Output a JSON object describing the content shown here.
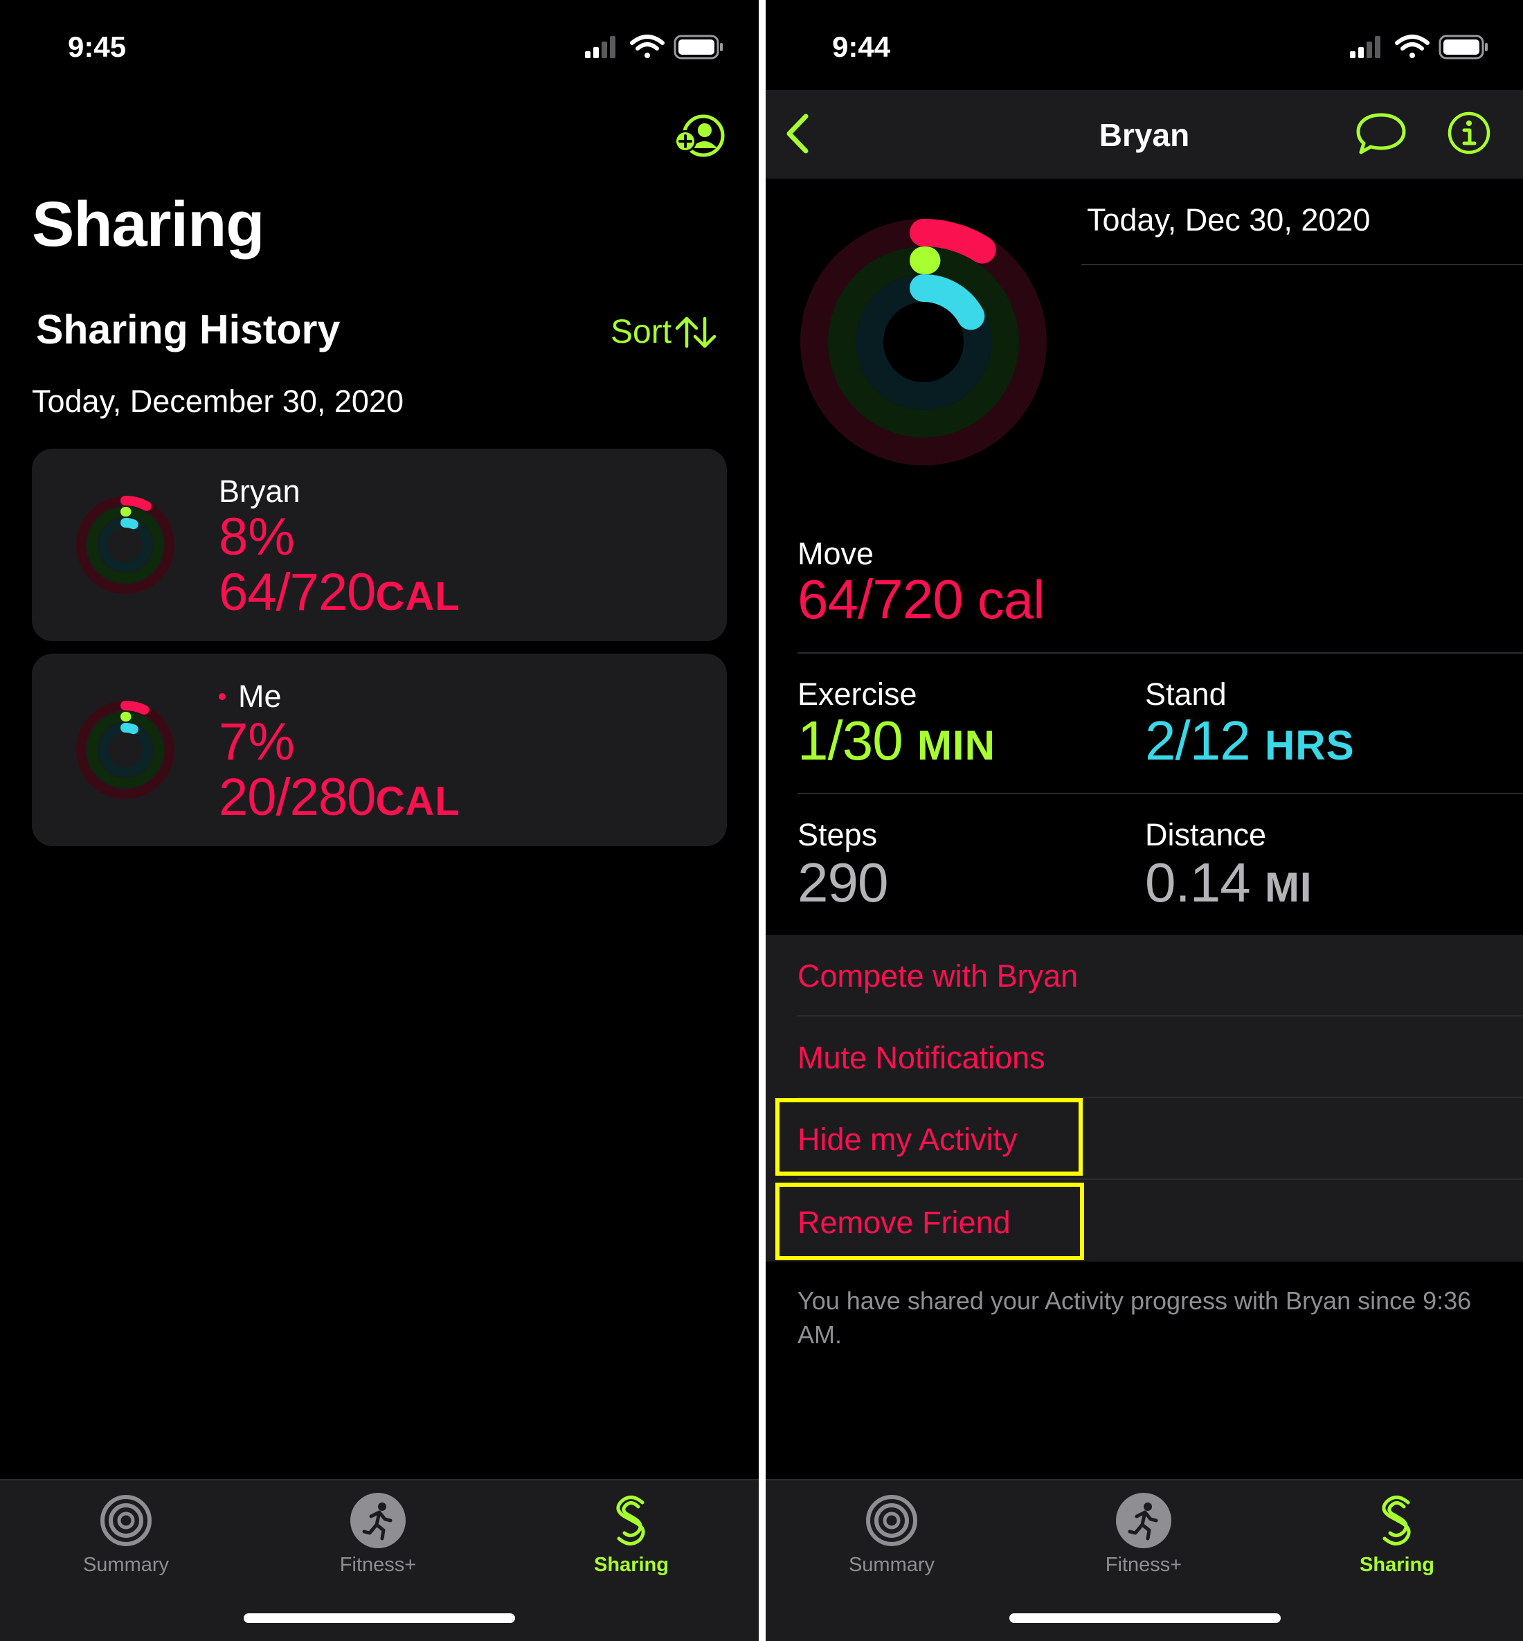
{
  "left": {
    "status_time": "9:45",
    "title": "Sharing",
    "section_title": "Sharing History",
    "sort_label": "Sort",
    "date_header": "Today, December 30, 2020",
    "cards": [
      {
        "name": "Bryan",
        "percent": "8%",
        "calories": "64/720",
        "unit": "CAL",
        "is_me": false,
        "move_progress": 0.08
      },
      {
        "name": "Me",
        "percent": "7%",
        "calories": "20/280",
        "unit": "CAL",
        "is_me": true,
        "move_progress": 0.07
      }
    ]
  },
  "right": {
    "status_time": "9:44",
    "nav_title": "Bryan",
    "date": "Today, Dec 30, 2020",
    "move": {
      "label": "Move",
      "value": "64/720",
      "unit": "cal",
      "progress": 0.09
    },
    "exercise": {
      "label": "Exercise",
      "value": "1/30",
      "unit": "MIN",
      "progress": 0.03
    },
    "stand": {
      "label": "Stand",
      "value": "2/12",
      "unit": "HRS",
      "progress": 0.17
    },
    "steps": {
      "label": "Steps",
      "value": "290"
    },
    "distance": {
      "label": "Distance",
      "value": "0.14",
      "unit": "MI"
    },
    "actions": [
      "Compete with Bryan",
      "Mute Notifications",
      "Hide my Activity",
      "Remove Friend"
    ],
    "highlighted_actions": [
      "Hide my Activity",
      "Remove Friend"
    ],
    "footer_note": "You have shared your Activity progress with Bryan since 9:36 AM."
  },
  "tabs": [
    {
      "label": "Summary",
      "icon": "summary-rings-icon",
      "active": false
    },
    {
      "label": "Fitness+",
      "icon": "running-figure-icon",
      "active": false
    },
    {
      "label": "Sharing",
      "icon": "sharing-s-icon",
      "active": true
    }
  ],
  "colors": {
    "move": "#fa114f",
    "exercise": "#a8ff2f",
    "stand": "#3ad8e8",
    "accent": "#a8ff2f",
    "highlight": "#ffff00",
    "background": "#000000",
    "card": "#1c1c1e"
  }
}
